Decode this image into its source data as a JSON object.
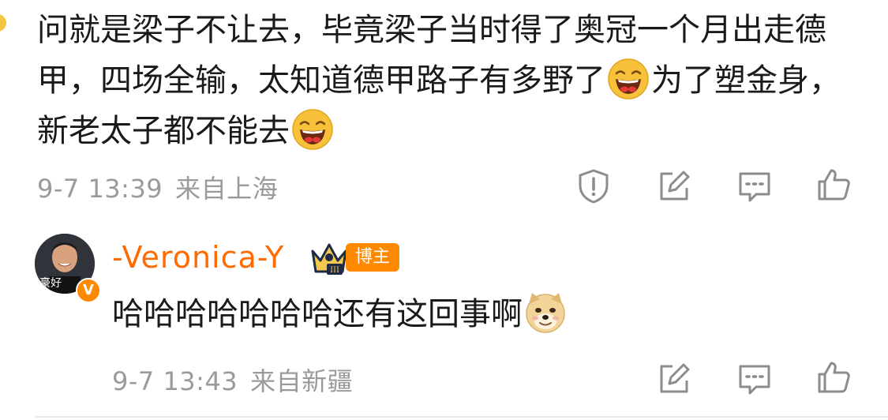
{
  "comment": {
    "text_part1": "问就是梁子不让去，毕竟梁子当时得了奥冠一个月出走德甲，四场全输，太知道德甲路子有多野了",
    "text_part2": "为了塑金身，新老太子都不能去",
    "time": "9-7 13:39",
    "location": "来自上海",
    "icons": [
      "report-icon",
      "repost-icon",
      "reply-icon",
      "like-icon"
    ]
  },
  "reply": {
    "username": "-Veronica-Y",
    "avatar_caption": "豪好",
    "verified_badge": "V",
    "role_tag": "博主",
    "text": "哈哈哈哈哈哈哈还有这回事啊",
    "time": "9-7 13:43",
    "location": "来自新疆",
    "icons": [
      "repost-icon",
      "reply-icon",
      "like-icon"
    ]
  },
  "colors": {
    "text": "#1a1a1a",
    "meta": "#9a9a9a",
    "username": "#ff6b00",
    "tag": "#ff8a00",
    "icon": "#8c8c8c"
  }
}
